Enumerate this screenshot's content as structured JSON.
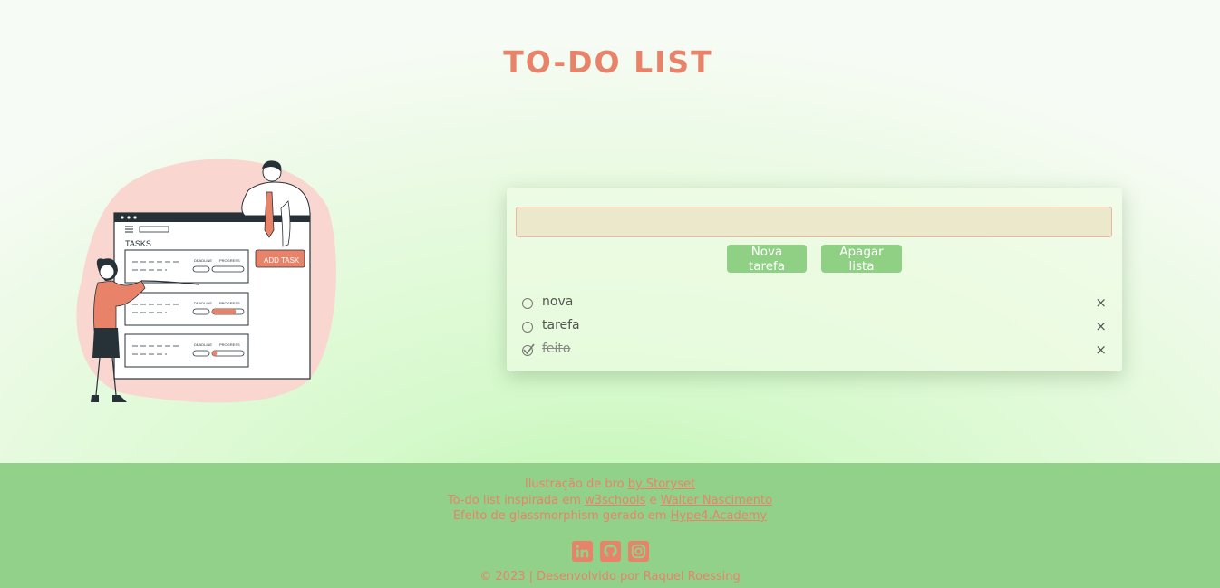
{
  "header": {
    "title": "TO-DO LIST"
  },
  "illustration": {
    "panel_title": "TASKS",
    "button_label": "ADD TASK",
    "col_deadline": "DEADLINE",
    "col_progress": "PROGRESS",
    "progress": [
      0.0,
      0.75,
      0.15
    ]
  },
  "form": {
    "input_value": "",
    "input_placeholder": "",
    "new_task_label": "Nova tarefa",
    "clear_list_label": "Apagar lista"
  },
  "tasks": [
    {
      "text": "nova",
      "done": false
    },
    {
      "text": "tarefa",
      "done": false
    },
    {
      "text": "feito",
      "done": true
    }
  ],
  "remove_symbol": "×",
  "footer": {
    "line1": {
      "prefix": "Ilustração de bro ",
      "link": "by Storyset"
    },
    "line2": {
      "prefix": "To-do list inspirada em ",
      "link1": "w3schools",
      "mid": " e ",
      "link2": "Walter Nascimento"
    },
    "line3": {
      "prefix": "Efeito de glassmorphism gerado em ",
      "link": "Hype4.Academy"
    },
    "socials": [
      "linkedin-icon",
      "github-icon",
      "instagram-icon"
    ],
    "copyright": "© 2023 | Desenvolvido por Raquel Roessing"
  },
  "colors": {
    "accent": "#e8836a",
    "green_button": "#8fd084",
    "footer_bg": "#92d189",
    "blob": "#f9d6d0"
  }
}
